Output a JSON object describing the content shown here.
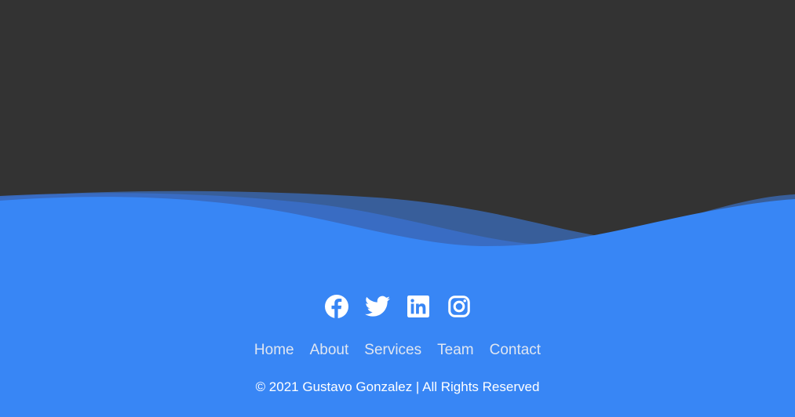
{
  "colors": {
    "background": "#333333",
    "footer": "#3886f5",
    "wave_back": "#3a6dc0",
    "wave_mid": "#386fc9",
    "nav_text": "#dfe6f2",
    "copyright_text": "#ffffff"
  },
  "social": [
    {
      "icon": "facebook-icon"
    },
    {
      "icon": "twitter-icon"
    },
    {
      "icon": "linkedin-icon"
    },
    {
      "icon": "instagram-icon"
    }
  ],
  "nav": {
    "items": [
      "Home",
      "About",
      "Services",
      "Team",
      "Contact"
    ]
  },
  "footer": {
    "copyright": "© 2021 Gustavo Gonzalez | All Rights Reserved"
  }
}
